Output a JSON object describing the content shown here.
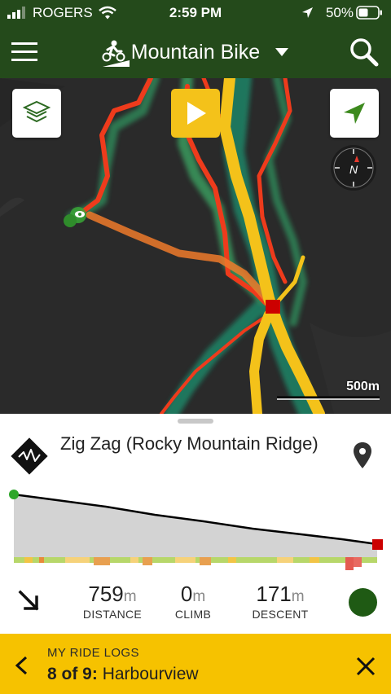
{
  "status_bar": {
    "carrier": "ROGERS",
    "time": "2:59 PM",
    "battery": "50%",
    "battery_level": 0.5
  },
  "header": {
    "activity": "Mountain Bike",
    "icons": [
      "menu-icon",
      "mountain-bike-icon",
      "caret-down-icon",
      "search-icon"
    ]
  },
  "map": {
    "scale_label": "500m",
    "compass_label": "N",
    "controls": [
      "layers-icon",
      "play-icon",
      "locate-arrow-icon",
      "compass-icon"
    ],
    "colors": {
      "background": "#2a2a2a",
      "trail_red": "#ee3b1c",
      "trail_orange": "#ee7a2a",
      "trail_yellow": "#f4c21a",
      "start": "#3aa636",
      "end": "#cc0000"
    }
  },
  "trail": {
    "name": "Zig Zag (Rocky Mountain Ridge)",
    "distance_value": "759",
    "distance_unit": "m",
    "distance_label": "DISTANCE",
    "climb_value": "0",
    "climb_unit": "m",
    "climb_label": "CLIMB",
    "descent_value": "171",
    "descent_unit": "m",
    "descent_label": "DESCENT",
    "difficulty_color": "#1f5a14",
    "icons": [
      "trail-logo-icon",
      "location-pin-icon",
      "descent-arrow-icon",
      "difficulty-dot-icon"
    ]
  },
  "footer": {
    "label": "MY RIDE LOGS",
    "position": "8 of 9:",
    "name": "Harbourview",
    "icons": [
      "back-chevron-icon",
      "close-icon"
    ]
  }
}
